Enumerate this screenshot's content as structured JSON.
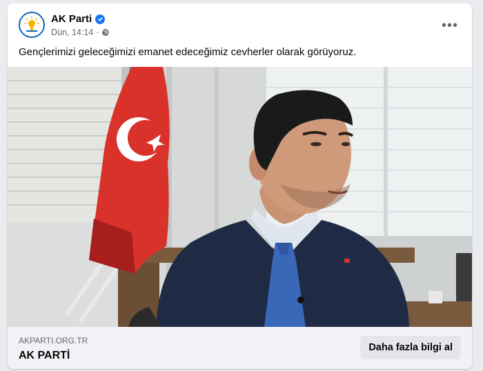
{
  "post": {
    "author": "AK Parti",
    "timestamp": "Dün, 14:14",
    "separator": "·",
    "privacy_icon": "globe-icon",
    "more_icon": "more-options-icon",
    "more_label": "•••",
    "caption": "Gençlerimizi geleceğimizi emanet edeceğimiz cevherler olarak görüyoruz."
  },
  "link": {
    "domain": "AKPARTI.ORG.TR",
    "title": "AK PARTİ",
    "cta_label": "Daha fazla bilgi al"
  },
  "colors": {
    "verified": "#1877f2",
    "flag_red": "#d9322b",
    "suit": "#1f2a44",
    "tie": "#3a68b8"
  }
}
